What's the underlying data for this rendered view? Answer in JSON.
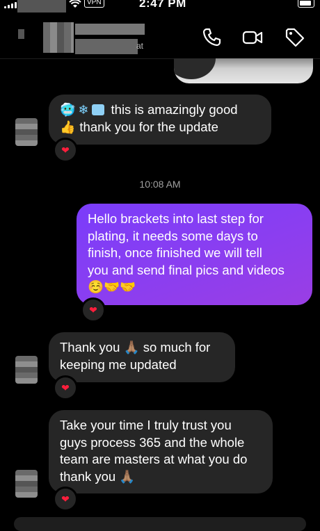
{
  "status_bar": {
    "time": "2:47 PM",
    "vpn_label": "VPN"
  },
  "header": {
    "contact_subtitle_fragment": "at",
    "icons": [
      "back-icon",
      "phone-icon",
      "video-camera-icon",
      "tag-icon"
    ]
  },
  "messages": [
    {
      "side": "received",
      "text_line1": "🥶 ❄️ 🧊  this is amazingly good",
      "text_line2": "👍🏻 thank you for the update",
      "reaction": "❤️"
    },
    {
      "side": "timestamp",
      "text": "10:08 AM"
    },
    {
      "side": "sent",
      "lines": [
        "Hello brackets into last step for",
        "plating,  it needs some days to",
        "finish,  once finished we will tell",
        "you and send final pics and videos",
        "☺️🤝🤝"
      ],
      "reaction": "❤️"
    },
    {
      "side": "received",
      "lines": [
        "Thank you 🙏🏽 so much for",
        "keeping me updated"
      ],
      "reaction": "❤️"
    },
    {
      "side": "received",
      "lines": [
        "Take your time I truly trust you",
        "guys process 365 and the whole",
        "team are masters at what you do",
        "thank you 🙏🏽"
      ],
      "reaction": "❤️"
    }
  ],
  "colors": {
    "background": "#000000",
    "received_bubble": "#262626",
    "sent_bubble": "#8b3ef0",
    "heart": "#ff1e3c"
  }
}
